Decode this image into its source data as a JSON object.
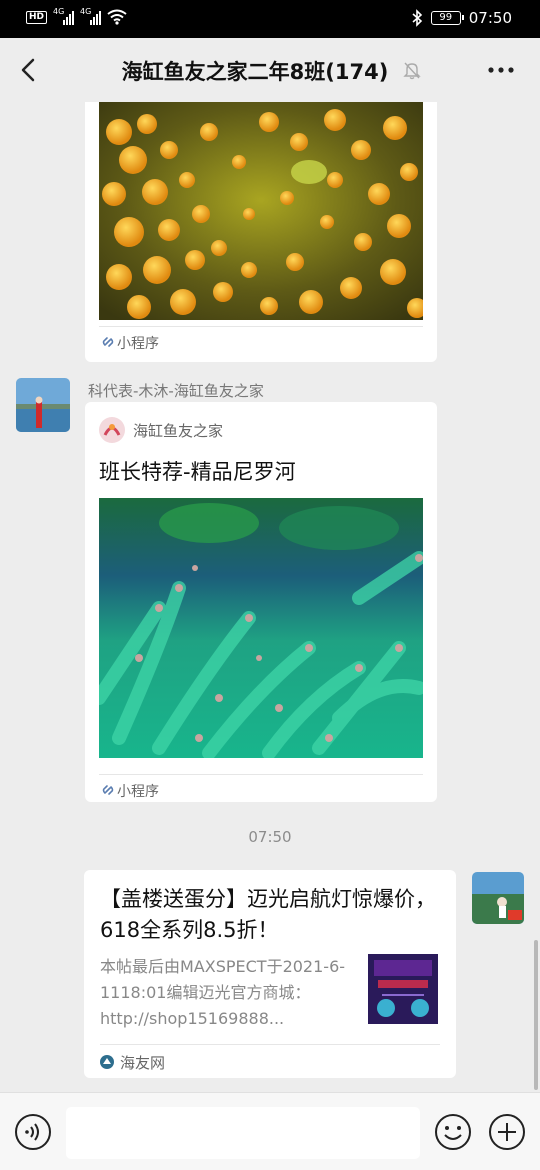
{
  "status_bar": {
    "hd": "HD",
    "net1": "4G",
    "net2": "4G",
    "battery": "99",
    "time": "07:50"
  },
  "header": {
    "title": "海缸鱼友之家二年8班(174)"
  },
  "messages": [
    {
      "type": "mini-program",
      "footer_label": "小程序"
    },
    {
      "type": "mini-program",
      "sender": "科代表-木沐-海缸鱼友之家",
      "source": "海缸鱼友之家",
      "title": "班长特荐-精品尼罗河",
      "footer_label": "小程序"
    },
    {
      "type": "timestamp",
      "time": "07:50"
    },
    {
      "type": "link",
      "title": "【盖楼送蛋分】迈光启航灯惊爆价，618全系列8.5折！",
      "desc": "本帖最后由MAXSPECT于2021-6-1118:01编辑迈光官方商城：http://shop15169888...",
      "source": "海友网"
    }
  ],
  "colors": {
    "background": "#ededed",
    "card": "#ffffff",
    "header_bar": "#000000"
  }
}
